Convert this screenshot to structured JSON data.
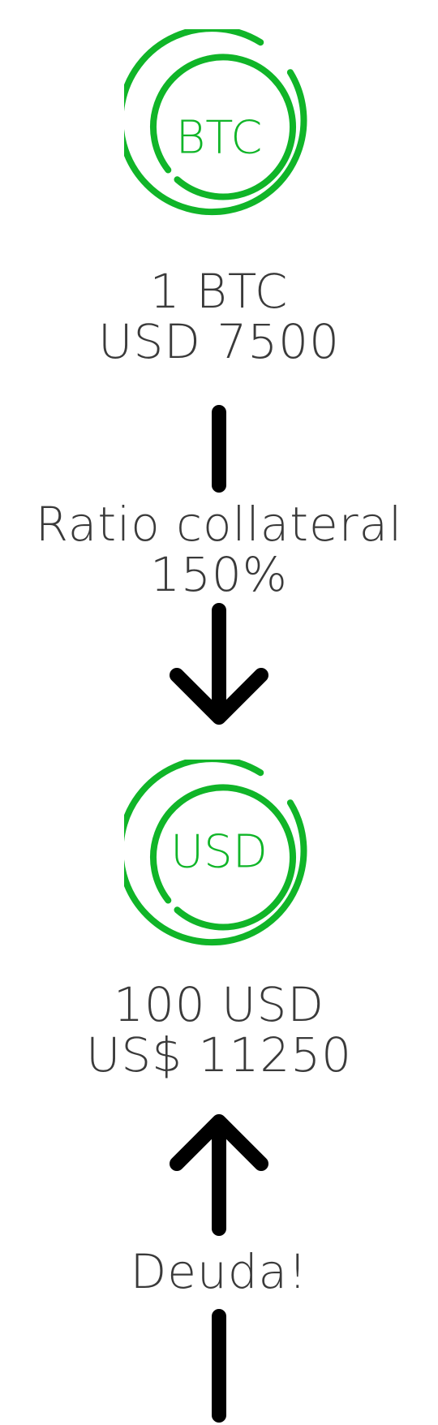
{
  "diagram": {
    "btc_coin": {
      "label": "BTC",
      "color": "#10b528"
    },
    "btc_value": {
      "line1": "1 BTC",
      "line2": "USD 7500"
    },
    "ratio": {
      "line1": "Ratio collateral",
      "line2": "150%"
    },
    "usd_coin": {
      "label": "USD",
      "color": "#10b528"
    },
    "usd_value": {
      "line1": "100 USD",
      "line2": "US$ 11250"
    },
    "debt": {
      "label": "Deuda!"
    },
    "text_color": "#3a3a3a",
    "arrow_color": "#000000"
  }
}
